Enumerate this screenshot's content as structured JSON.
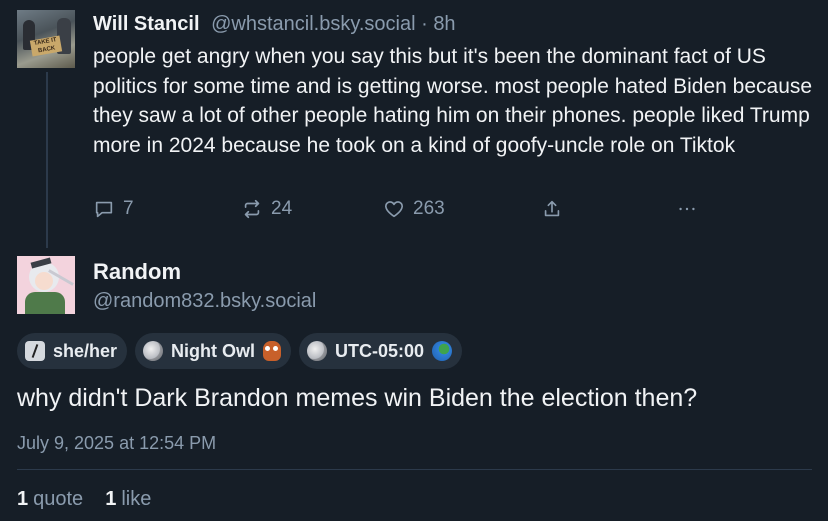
{
  "parent_post": {
    "author_name": "Will Stancil",
    "author_handle": "@whstancil.bsky.social",
    "separator": " · ",
    "time_ago": "8h",
    "avatar_sign_text": "TAKE IT BACK",
    "text": "people get angry when you say this but it's been the dominant fact of US politics for some time and is getting worse. most people hated Biden because they saw a lot of other people hating him on their phones. people liked Trump more in 2024 because he took on a kind of goofy-uncle role on Tiktok",
    "actions": {
      "reply_count": "7",
      "repost_count": "24",
      "like_count": "263"
    }
  },
  "main_post": {
    "author_name": "Random",
    "author_handle": "@random832.bsky.social",
    "badges": [
      {
        "label": "she/her",
        "icon": "slash-icon"
      },
      {
        "label": "Night Owl",
        "icon": "moon-icon",
        "trailing_icon": "owl-icon"
      },
      {
        "label": "UTC-05:00",
        "icon": "moon-icon",
        "trailing_icon": "globe-icon"
      }
    ],
    "text": "why didn't Dark Brandon memes win Biden the election then?",
    "timestamp": "July 9, 2025 at 12:54 PM",
    "stats": {
      "quote_count": "1",
      "quote_label": "quote",
      "like_count": "1",
      "like_label": "like"
    }
  },
  "colors": {
    "background": "#161e27",
    "muted_text": "#8a9bad",
    "primary_text": "#f1f3f5",
    "badge_bg": "#26313d"
  }
}
